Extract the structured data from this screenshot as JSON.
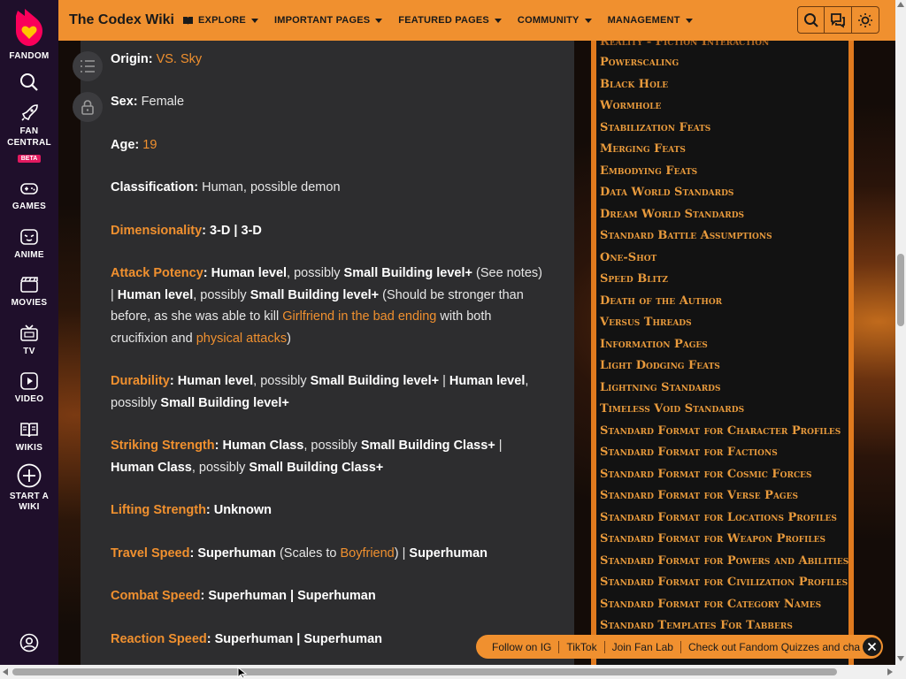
{
  "rail": {
    "brand": "FANDOM",
    "items": [
      {
        "label": "FAN",
        "label2": "CENTRAL",
        "badge": "BETA"
      },
      {
        "label": "GAMES"
      },
      {
        "label": "ANIME"
      },
      {
        "label": "MOVIES"
      },
      {
        "label": "TV"
      },
      {
        "label": "VIDEO"
      },
      {
        "label": "WIKIS"
      },
      {
        "label": "START A",
        "label2": "WIKI"
      }
    ]
  },
  "header": {
    "wiki_name": "The Codex Wiki",
    "nav": [
      "EXPLORE",
      "IMPORTANT PAGES",
      "FEATURED PAGES",
      "COMMUNITY",
      "MANAGEMENT"
    ]
  },
  "article": {
    "origin_label": "Origin:",
    "origin_value": "VS. Sky",
    "sex_label": "Sex:",
    "sex_value": "Female",
    "age_label": "Age:",
    "age_value": "19",
    "class_label": "Classification:",
    "class_value": "Human, possible demon",
    "dim_label": "Dimensionality",
    "dim_value": ": 3-D | 3-D",
    "ap_label": "Attack Potency",
    "ap_p1": ": Human level",
    "ap_p2": ", possibly ",
    "ap_p3": "Small Building level+",
    "ap_p4": " (See notes) | ",
    "ap_p5": "Human level",
    "ap_p6": ", possibly ",
    "ap_p7": "Small Building level+",
    "ap_p8": " (Should be stronger than before, as she was able to kill ",
    "ap_link1": "Girlfriend in the bad ending",
    "ap_p9": " with both crucifixion and ",
    "ap_link2": "physical attacks",
    "ap_p10": ")",
    "dur_label": "Durability",
    "dur_p1": ": Human level",
    "dur_p2": ", possibly ",
    "dur_p3": "Small Building level+",
    "dur_p4": " | ",
    "dur_p5": "Human level",
    "dur_p6": ", possibly ",
    "dur_p7": "Small Building level+",
    "ss_label": "Striking Strength",
    "ss_p1": ": Human Class",
    "ss_p2": ", possibly ",
    "ss_p3": "Small Building Class+",
    "ss_p4": " | ",
    "ss_p5": "Human Class",
    "ss_p6": ", possibly ",
    "ss_p7": "Small Building Class+",
    "ls_label": "Lifting Strength",
    "ls_value": ": Unknown",
    "ts_label": "Travel Speed",
    "ts_p1": ": Superhuman",
    "ts_p2": " (Scales to ",
    "ts_link": "Boyfriend",
    "ts_p3": ") | ",
    "ts_p4": "Superhuman",
    "cs_label": "Combat Speed",
    "cs_value": ": Superhuman | Superhuman",
    "rs_label": "Reaction Speed",
    "rs_value": ": Superhuman | Superhuman"
  },
  "sidebar": {
    "links": [
      "Reality - Fiction Interaction",
      "Powerscaling",
      "Black Hole",
      "Wormhole",
      "Stabilization Feats",
      "Merging Feats",
      "Embodying Feats",
      "Data World Standards",
      "Dream World Standards",
      "Standard Battle Assumptions",
      "One-Shot",
      "Speed Blitz",
      "Death of the Author",
      "Versus Threads",
      "Information Pages",
      "Light Dodging Feats",
      "Lightning Standards",
      "Timeless Void Standards",
      "Standard Format for Character Profiles",
      "Standard Format for Factions",
      "Standard Format for Cosmic Forces",
      "Standard Format for Verse Pages",
      "Standard Format for Locations Profiles",
      "Standard Format for Weapon Profiles",
      "Standard Format for Powers and Abilities",
      "Standard Format for Civilization Profiles",
      "Standard Format for Category Names",
      "Standard Templates For Tabbers"
    ]
  },
  "notification": {
    "items": [
      "Follow on IG",
      "TikTok",
      "Join Fan Lab",
      "Check out Fandom Quizzes and cha"
    ]
  },
  "colors": {
    "accent": "#f0902f",
    "rail_bg": "#1f0f2b",
    "article_bg": "#2d2d2f",
    "sidebar_bg": "#121212"
  }
}
